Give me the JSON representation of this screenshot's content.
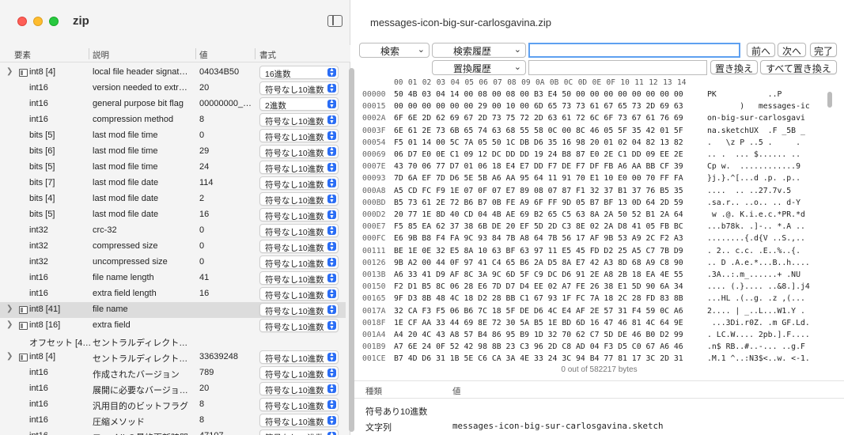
{
  "app": {
    "title": "zip",
    "document_title": "messages-icon-big-sur-carlosgavina.zip"
  },
  "columns": {
    "element": "要素",
    "description": "説明",
    "value": "値",
    "format": "書式"
  },
  "rows": [
    {
      "disclosure": true,
      "icon": true,
      "type": "int8 [4]",
      "desc": "local file header signat…",
      "value": "04034B50",
      "format": "16進数"
    },
    {
      "disclosure": false,
      "icon": false,
      "type": "int16",
      "desc": "version needed to extr…",
      "value": "20",
      "format": "符号なし10進数"
    },
    {
      "disclosure": false,
      "icon": false,
      "type": "int16",
      "desc": "general purpose bit flag",
      "value": "00000000_…",
      "format": "2進数"
    },
    {
      "disclosure": false,
      "icon": false,
      "type": "int16",
      "desc": "compression method",
      "value": "8",
      "format": "符号なし10進数"
    },
    {
      "disclosure": false,
      "icon": false,
      "type": "bits [5]",
      "desc": "last mod file time",
      "value": "0",
      "format": "符号なし10進数"
    },
    {
      "disclosure": false,
      "icon": false,
      "type": "bits [6]",
      "desc": "last mod file time",
      "value": "29",
      "format": "符号なし10進数"
    },
    {
      "disclosure": false,
      "icon": false,
      "type": "bits [5]",
      "desc": "last mod file time",
      "value": "24",
      "format": "符号なし10進数"
    },
    {
      "disclosure": false,
      "icon": false,
      "type": "bits [7]",
      "desc": "last mod file date",
      "value": "114",
      "format": "符号なし10進数"
    },
    {
      "disclosure": false,
      "icon": false,
      "type": "bits [4]",
      "desc": "last mod file date",
      "value": "2",
      "format": "符号なし10進数"
    },
    {
      "disclosure": false,
      "icon": false,
      "type": "bits [5]",
      "desc": "last mod file date",
      "value": "16",
      "format": "符号なし10進数"
    },
    {
      "disclosure": false,
      "icon": false,
      "type": "int32",
      "desc": "crc-32",
      "value": "0",
      "format": "符号なし10進数"
    },
    {
      "disclosure": false,
      "icon": false,
      "type": "int32",
      "desc": "compressed size",
      "value": "0",
      "format": "符号なし10進数"
    },
    {
      "disclosure": false,
      "icon": false,
      "type": "int32",
      "desc": "uncompressed size",
      "value": "0",
      "format": "符号なし10進数"
    },
    {
      "disclosure": false,
      "icon": false,
      "type": "int16",
      "desc": "file name length",
      "value": "41",
      "format": "符号なし10進数"
    },
    {
      "disclosure": false,
      "icon": false,
      "type": "int16",
      "desc": "extra field length",
      "value": "16",
      "format": "符号なし10進数"
    },
    {
      "disclosure": true,
      "icon": true,
      "type": "int8 [41]",
      "desc": "file name",
      "value": "",
      "format": "符号なし10進数",
      "selected": true
    },
    {
      "disclosure": true,
      "icon": true,
      "type": "int8 [16]",
      "desc": "extra field",
      "value": "",
      "format": "符号なし10進数"
    },
    {
      "disclosure": false,
      "icon": false,
      "type": "オフセット [4…",
      "desc": "セントラルディレクトリ…",
      "value": "",
      "format": ""
    },
    {
      "disclosure": true,
      "icon": true,
      "type": "int8 [4]",
      "desc": "セントラルディレクトリ…",
      "value": "33639248",
      "format": "符号なし10進数"
    },
    {
      "disclosure": false,
      "icon": false,
      "type": "int16",
      "desc": "作成されたバージョン",
      "value": "789",
      "format": "符号なし10進数"
    },
    {
      "disclosure": false,
      "icon": false,
      "type": "int16",
      "desc": "展開に必要なバージョン…",
      "value": "20",
      "format": "符号なし10進数"
    },
    {
      "disclosure": false,
      "icon": false,
      "type": "int16",
      "desc": "汎用目的のビットフラグ",
      "value": "8",
      "format": "符号なし10進数"
    },
    {
      "disclosure": false,
      "icon": false,
      "type": "int16",
      "desc": "圧縮メソッド",
      "value": "8",
      "format": "符号なし10進数"
    },
    {
      "disclosure": false,
      "icon": false,
      "type": "int16",
      "desc": "ファイルの最終更新時間",
      "value": "47107",
      "format": "符号なし10進数"
    }
  ],
  "toolbar": {
    "search_mode": "検索",
    "search_history": "検索履歴",
    "search_value": "",
    "prev": "前へ",
    "next": "次へ",
    "done": "完了",
    "replace_history": "置換履歴",
    "replace_value": "",
    "replace": "置き換え",
    "replace_all": "すべて置き換え"
  },
  "hex": {
    "columns": [
      "00",
      "01",
      "02",
      "03",
      "04",
      "05",
      "06",
      "07",
      "08",
      "09",
      "0A",
      "0B",
      "0C",
      "0D",
      "0E",
      "0F",
      "10",
      "11",
      "12",
      "13",
      "14"
    ],
    "rows": [
      {
        "offset": "00000",
        "bytes": "50 4B 03 04 14 00 08 00 08 00 B3 E4 50 00 00 00 00 00 00 00 00",
        "ascii": "PK           ..P"
      },
      {
        "offset": "00015",
        "bytes": "00 00 00 00 00 00 29 00 10 00 6D 65 73 73 61 67 65 73 2D 69 63",
        "ascii": "       )   messages-ic"
      },
      {
        "offset": "0002A",
        "bytes": "6F 6E 2D 62 69 67 2D 73 75 72 2D 63 61 72 6C 6F 73 67 61 76 69",
        "ascii": "on-big-sur-carlosgavi"
      },
      {
        "offset": "0003F",
        "bytes": "6E 61 2E 73 6B 65 74 63 68 55 58 0C 00 8C 46 05 5F 35 42 01 5F",
        "ascii": "na.sketchUX  .F _5B _"
      },
      {
        "offset": "00054",
        "bytes": "F5 01 14 00 5C 7A 05 50 1C DB D6 35 16 98 20 01 02 04 82 13 82",
        "ascii": ".   \\z P ..5 .     ."
      },
      {
        "offset": "00069",
        "bytes": "06 D7 E0 0E C1 09 12 DC DD DD 19 24 B8 87 E0 2E C1 DD 09 EE 2E",
        "ascii": ".. .  ... $...... .."
      },
      {
        "offset": "0007E",
        "bytes": "43 70 06 77 D7 01 06 18 E4 E7 DD F7 DE F7 DF FB A6 AA BB CF 39",
        "ascii": "Cp w.  ............9"
      },
      {
        "offset": "00093",
        "bytes": "7D 6A EF 7D D6 5E 5B A6 AA 95 64 11 91 70 E1 10 E0 00 70 FF FA",
        "ascii": "}j.}.^[...d .p. .p.."
      },
      {
        "offset": "000A8",
        "bytes": "A5 CD FC F9 1E 07 0F 07 E7 89 08 07 87 F1 32 37 B1 37 76 B5 35",
        "ascii": "....  .. ..27.7v.5"
      },
      {
        "offset": "000BD",
        "bytes": "B5 73 61 2E 72 B6 B7 0B FE A9 6F FF 9D 05 B7 BF 13 0D 64 2D 59",
        "ascii": ".sa.r.. ..o.. .. d-Y"
      },
      {
        "offset": "000D2",
        "bytes": "20 77 1E 8D 40 CD 04 4B AE 69 B2 65 C5 63 8A 2A 50 52 B1 2A 64",
        "ascii": " w .@. K.i.e.c.*PR.*d"
      },
      {
        "offset": "000E7",
        "bytes": "F5 85 EA 62 37 38 6B DE 20 EF 5D 2D C3 8E 02 2A D8 41 05 FB BC",
        "ascii": "...b78k. .]-.. *.A .."
      },
      {
        "offset": "000FC",
        "bytes": "E6 9B B8 F4 FA 9C 93 84 7B A8 64 7B 56 17 AF 9B 53 A9 2C F2 A3",
        "ascii": "........{.d{V ..S.,.."
      },
      {
        "offset": "00111",
        "bytes": "BE 1E 0E 32 E5 8A 10 63 BF 63 97 11 E5 45 FD D2 25 A5 C7 7B D9",
        "ascii": ". 2.. c.c. .E..%..{."
      },
      {
        "offset": "00126",
        "bytes": "9B A2 00 44 0F 97 41 C4 65 B6 2A D5 8A E7 42 A3 8D 68 A9 C8 90",
        "ascii": ".. D .A.e.*...B..h...."
      },
      {
        "offset": "0013B",
        "bytes": "A6 33 41 D9 AF 8C 3A 9C 6D 5F C9 DC D6 91 2E A8 2B 18 EA 4E 55",
        "ascii": ".3A..:.m_......+ .NU"
      },
      {
        "offset": "00150",
        "bytes": "F2 D1 B5 8C 06 28 E6 7D D7 D4 EE 02 A7 FE 26 38 E1 5D 90 6A 34",
        "ascii": ".... (.}.... ..&8.].j4"
      },
      {
        "offset": "00165",
        "bytes": "9F D3 8B 48 4C 18 D2 28 BB C1 67 93 1F FC 7A 18 2C 28 FD 83 8B",
        "ascii": "...HL .(..g. .z ,(..."
      },
      {
        "offset": "0017A",
        "bytes": "32 CA F3 F5 06 B6 7C 18 5F DE D6 4C E4 AF 2E 57 31 F4 59 0C A6",
        "ascii": "2.... | _..L...W1.Y ."
      },
      {
        "offset": "0018F",
        "bytes": "1E CF AA 33 44 69 8E 72 30 5A B5 1E BD 6D 16 47 46 81 4C 64 9E",
        "ascii": " ...3Di.r0Z. .m GF.Ld."
      },
      {
        "offset": "001A4",
        "bytes": "A4 20 4C 43 A8 57 B4 86 95 B9 1D 32 70 62 C7 5D DE 46 B0 D2 99",
        "ascii": ". LC.W.... 2pb.].F...."
      },
      {
        "offset": "001B9",
        "bytes": "A7 6E 24 0F 52 42 98 8B 23 C3 96 2D C8 AD 04 F3 D5 C0 67 A6 46",
        "ascii": ".n$ RB..#..-... ..g.F"
      },
      {
        "offset": "001CE",
        "bytes": "B7 4D D6 31 1B 5E C6 CA 3A 4E 33 24 3C 94 B4 77 81 17 3C 2D 31",
        "ascii": ".M.1 ^..:N3$<..w. <-1."
      }
    ]
  },
  "status": "0 out of 582217 bytes",
  "inspector": {
    "col_type": "種類",
    "col_value": "値",
    "rows": [
      {
        "type": "符号あり10進数",
        "value": ""
      },
      {
        "type": "文字列",
        "value": "messages-icon-big-sur-carlosgavina.sketch"
      }
    ]
  }
}
